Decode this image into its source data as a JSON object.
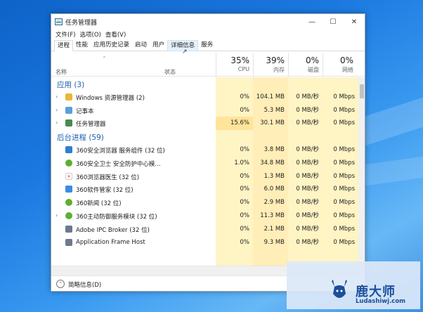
{
  "window": {
    "title": "任务管理器",
    "minimize_icon": "minimize-icon",
    "maximize_icon": "maximize-icon",
    "close_icon": "close-icon"
  },
  "menu": {
    "items": [
      "文件(F)",
      "选项(O)",
      "查看(V)"
    ]
  },
  "tabs": [
    "进程",
    "性能",
    "应用历史记录",
    "启动",
    "用户",
    "详细信息",
    "服务"
  ],
  "columns": {
    "name": "名称",
    "status": "状态",
    "cpu": {
      "pct": "35%",
      "label": "CPU"
    },
    "memory": {
      "pct": "39%",
      "label": "内存"
    },
    "disk": {
      "pct": "0%",
      "label": "磁盘"
    },
    "network": {
      "pct": "0%",
      "label": "网络"
    }
  },
  "groups": {
    "apps_label": "应用 (3)",
    "bg_label": "后台进程 (59)"
  },
  "apps": [
    {
      "name": "Windows 资源管理器 (2)",
      "icon": "folder-icon",
      "cpu": "0%",
      "mem": "104.1 MB",
      "disk": "0 MB/秒",
      "net": "0 Mbps"
    },
    {
      "name": "记事本",
      "icon": "notepad-icon",
      "cpu": "0%",
      "mem": "5.3 MB",
      "disk": "0 MB/秒",
      "net": "0 Mbps"
    },
    {
      "name": "任务管理器",
      "icon": "task-manager-icon",
      "cpu": "15.6%",
      "mem": "30.1 MB",
      "disk": "0 MB/秒",
      "net": "0 Mbps"
    }
  ],
  "background": [
    {
      "name": "360安全浏览器 服务组件 (32 位)",
      "icon": "360-browser-icon",
      "cpu": "0%",
      "mem": "3.8 MB",
      "disk": "0 MB/秒",
      "net": "0 Mbps"
    },
    {
      "name": "360安全卫士 安全防护中心模...",
      "icon": "360-safe-icon",
      "cpu": "1.0%",
      "mem": "34.8 MB",
      "disk": "0 MB/秒",
      "net": "0 Mbps"
    },
    {
      "name": "360浏览器医生 (32 位)",
      "icon": "360-doctor-icon",
      "cpu": "0%",
      "mem": "1.3 MB",
      "disk": "0 MB/秒",
      "net": "0 Mbps"
    },
    {
      "name": "360软件管家 (32 位)",
      "icon": "360-software-icon",
      "cpu": "0%",
      "mem": "6.0 MB",
      "disk": "0 MB/秒",
      "net": "0 Mbps"
    },
    {
      "name": "360新闻 (32 位)",
      "icon": "360-news-icon",
      "cpu": "0%",
      "mem": "2.9 MB",
      "disk": "0 MB/秒",
      "net": "0 Mbps"
    },
    {
      "name": "360主动防御服务模块 (32 位)",
      "icon": "360-defense-icon",
      "cpu": "0%",
      "mem": "11.3 MB",
      "disk": "0 MB/秒",
      "net": "0 Mbps"
    },
    {
      "name": "Adobe IPC Broker (32 位)",
      "icon": "adobe-icon",
      "cpu": "0%",
      "mem": "2.1 MB",
      "disk": "0 MB/秒",
      "net": "0 Mbps"
    },
    {
      "name": "Application Frame Host",
      "icon": "app-frame-icon",
      "cpu": "0%",
      "mem": "9.3 MB",
      "disk": "0 MB/秒",
      "net": "0 Mbps"
    }
  ],
  "footer": {
    "label": "简略信息(D)"
  },
  "watermark": {
    "title": "鹿大师",
    "url": "Ludashiwj.com"
  }
}
